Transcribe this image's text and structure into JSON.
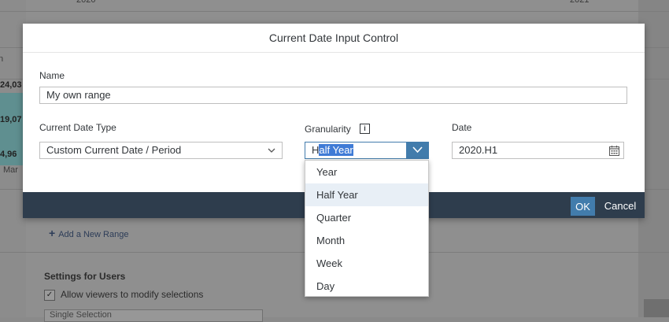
{
  "background": {
    "axis_labels": [
      "2020",
      "2021"
    ],
    "values": [
      "24,03",
      "19,07",
      "4,96"
    ],
    "month": "Mar",
    "add_range": "Add a New Range",
    "settings_title": "Settings for Users",
    "allow_viewers": "Allow viewers to modify selections",
    "selection_mode": "Single Selection"
  },
  "dialog": {
    "title": "Current Date Input Control",
    "name_label": "Name",
    "name_value": "My own range",
    "type_label": "Current Date Type",
    "type_value": "Custom Current Date / Period",
    "granularity_label": "Granularity",
    "granularity_value_prefix": "H",
    "granularity_value_selected": "alf Year",
    "date_label": "Date",
    "date_value": "2020.H1",
    "ok_label": "OK",
    "cancel_label": "Cancel",
    "info_glyph": "i"
  },
  "dropdown": {
    "options": [
      "Year",
      "Half Year",
      "Quarter",
      "Month",
      "Week",
      "Day"
    ],
    "selected_index": 1
  },
  "colors": {
    "accent": "#427cac",
    "footer": "#2e3d4d",
    "selection_highlight": "#3f7bd6"
  },
  "icons": {
    "chevron": "chevron-down-icon",
    "calendar": "calendar-icon",
    "info": "info-icon"
  }
}
